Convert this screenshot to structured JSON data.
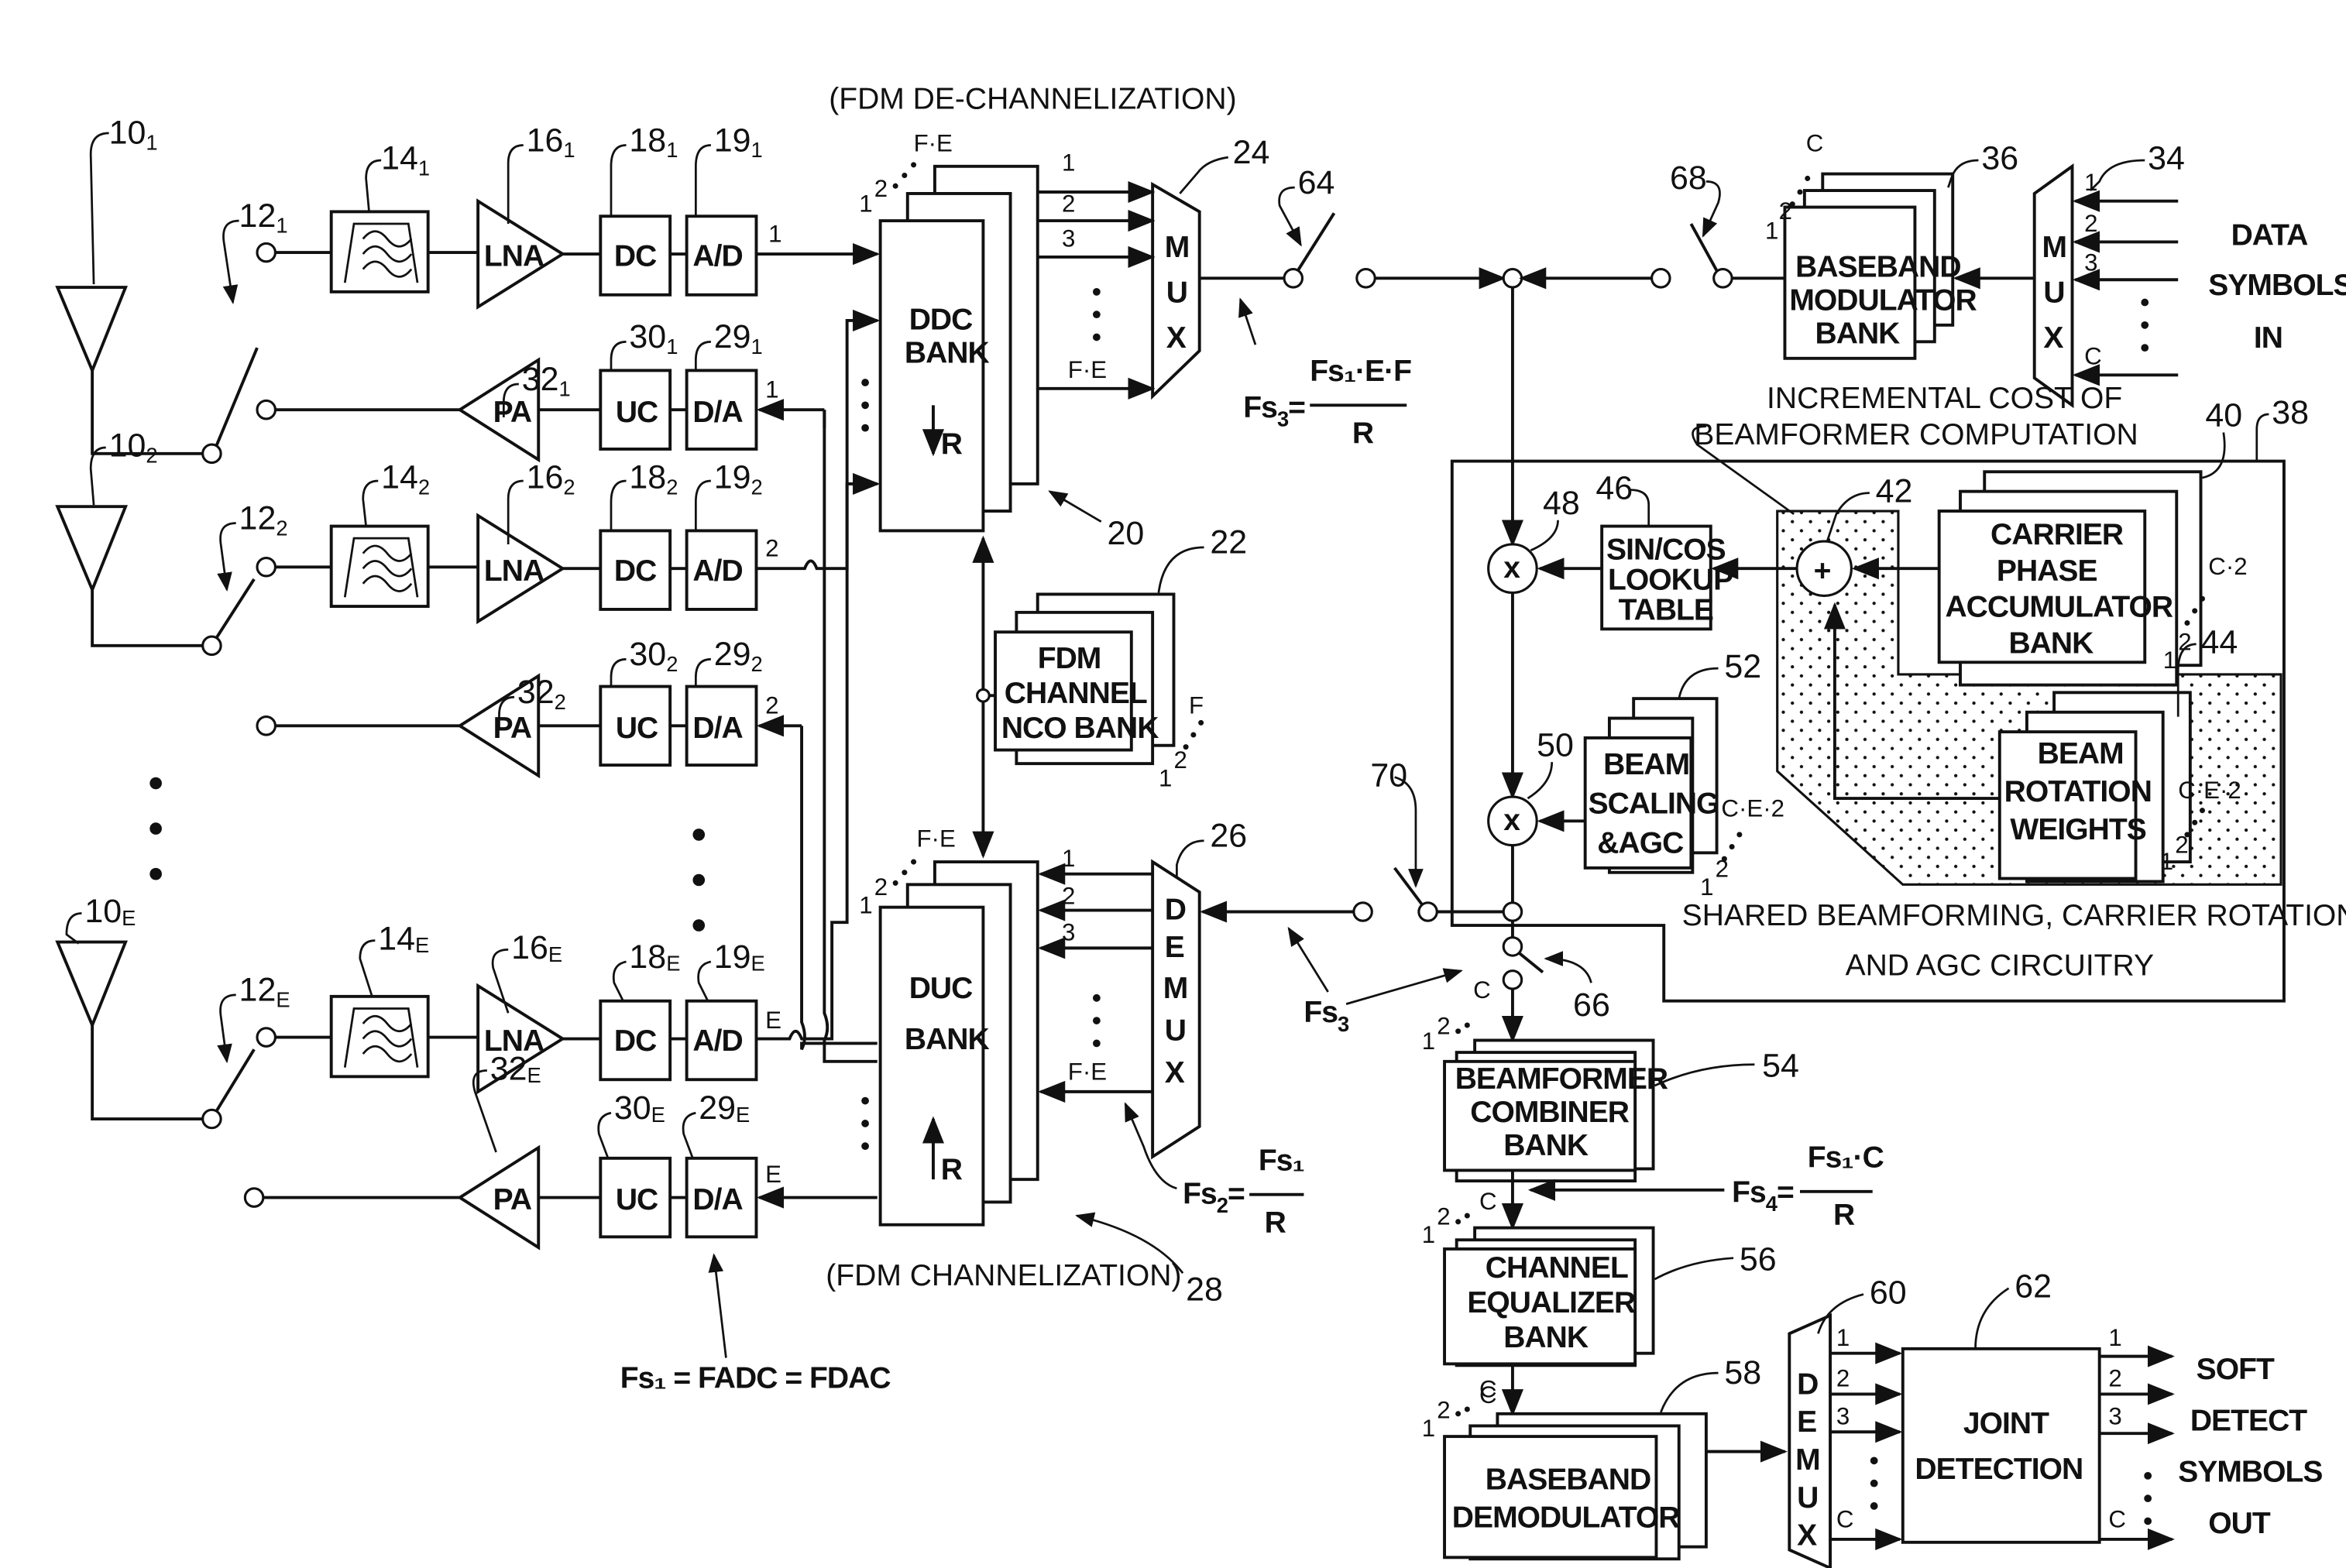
{
  "figure": {
    "headings": {
      "dechannelization": "(FDM DE-CHANNELIZATION)",
      "channelization": "(FDM CHANNELIZATION)",
      "incremental_cost_line1": "INCREMENTAL COST OF",
      "incremental_cost_line2": "BEAMFORMER COMPUTATION",
      "shared_line1": "SHARED BEAMFORMING, CARRIER ROTATION,",
      "shared_line2": "AND AGC CIRCUITRY"
    },
    "antenna_rows": [
      {
        "antenna_ref": "10",
        "switch_ref": "12",
        "filter_ref": "14",
        "lna_ref": "16",
        "dc_ref": "18",
        "ad_ref": "19",
        "pa_ref": "32",
        "uc_ref": "30",
        "da_ref": "29",
        "index": "1",
        "port": "1"
      },
      {
        "antenna_ref": "10",
        "switch_ref": "12",
        "filter_ref": "14",
        "lna_ref": "16",
        "dc_ref": "18",
        "ad_ref": "19",
        "pa_ref": "32",
        "uc_ref": "30",
        "da_ref": "29",
        "index": "2",
        "port": "2"
      },
      {
        "antenna_ref": "10",
        "switch_ref": "12",
        "filter_ref": "14",
        "lna_ref": "16",
        "dc_ref": "18",
        "ad_ref": "19",
        "pa_ref": "32",
        "uc_ref": "30",
        "da_ref": "29",
        "index": "E",
        "port": "E"
      }
    ],
    "block_labels": {
      "lna": "LNA",
      "dc": "DC",
      "ad": "A/D",
      "pa": "PA",
      "uc": "UC",
      "da": "D/A"
    },
    "ddc_bank": {
      "line1": "DDC",
      "line2": "BANK",
      "rate": "R",
      "ref": "20",
      "stack_top": "F·E",
      "stack_1": "1",
      "stack_2": "2"
    },
    "duc_bank": {
      "line1": "DUC",
      "line2": "BANK",
      "rate": "R",
      "ref": "28",
      "stack_top": "F·E",
      "stack_1": "1",
      "stack_2": "2"
    },
    "nco_bank": {
      "line1": "FDM",
      "line2": "CHANNEL",
      "line3": "NCO BANK",
      "ref": "22",
      "stack_top": "F",
      "stack_1": "1",
      "stack_2": "2"
    },
    "mux_24": {
      "letters": [
        "M",
        "U",
        "X"
      ],
      "ref": "24",
      "ports": [
        "1",
        "2",
        "3",
        "F·E"
      ]
    },
    "demux_26": {
      "letters": [
        "D",
        "E",
        "M",
        "U",
        "X"
      ],
      "ref": "26",
      "ports": [
        "1",
        "2",
        "3",
        "F·E"
      ]
    },
    "switches": {
      "s64": "64",
      "s68": "68",
      "s70": "70",
      "s66": "66"
    },
    "rates": {
      "fs3_lhs": "Fs",
      "fs3_sub": "3",
      "fs3_num": "Fs₁·E·F",
      "fs3_den": "R",
      "fs2_lhs": "Fs",
      "fs2_sub": "2",
      "fs2_num": "Fs₁",
      "fs2_den": "R",
      "fs4_lhs": "Fs",
      "fs4_sub": "4",
      "fs4_num": "Fs₁·C",
      "fs4_den": "R",
      "fs3_lower": "Fs",
      "fs3_lower_sub": "3",
      "fs1_eq": "Fs₁ = FADC = FDAC"
    },
    "baseband_mod": {
      "line1": "BASEBAND",
      "line2": "MODULATOR",
      "line3": "BANK",
      "ref": "36",
      "stack_top": "C",
      "stack_1": "1",
      "stack_2": "2"
    },
    "mux_34": {
      "letters": [
        "M",
        "U",
        "X"
      ],
      "ref": "34",
      "ports": [
        "1",
        "2",
        "3",
        "C"
      ]
    },
    "data_in": {
      "line1": "DATA",
      "line2": "SYMBOLS",
      "line3": "IN"
    },
    "shared_block": {
      "ref": "38"
    },
    "multiplier_48": {
      "symbol": "x",
      "ref": "48"
    },
    "multiplier_50": {
      "symbol": "x",
      "ref": "50"
    },
    "adder_42": {
      "symbol": "+",
      "ref": "42"
    },
    "sincos": {
      "line1": "SIN/COS",
      "line2": "LOOKUP",
      "line3": "TABLE",
      "ref": "46"
    },
    "carrier_acc": {
      "line1": "CARRIER",
      "line2": "PHASE",
      "line3": "ACCUMULATOR",
      "line4": "BANK",
      "ref": "40",
      "stack_top": "C·2",
      "stack_1": "1",
      "stack_2": "2"
    },
    "beam_rot": {
      "line1": "BEAM",
      "line2": "ROTATION",
      "line3": "WEIGHTS",
      "ref": "44",
      "stack_top": "C·E·2",
      "stack_1": "1",
      "stack_2": "2"
    },
    "beam_scale": {
      "line1": "BEAM",
      "line2": "SCALING",
      "line3": "&AGC",
      "ref": "52",
      "stack_top": "C·E·2",
      "stack_1": "1",
      "stack_2": "2"
    },
    "combiner": {
      "line1": "BEAMFORMER",
      "line2": "COMBINER",
      "line3": "BANK",
      "ref": "54",
      "stack_top": "C",
      "stack_1": "1",
      "stack_2": "2"
    },
    "equalizer": {
      "line1": "CHANNEL",
      "line2": "EQUALIZER",
      "line3": "BANK",
      "ref": "56",
      "stack_top": "C",
      "stack_1": "1",
      "stack_2": "2"
    },
    "demodulator": {
      "line1": "BASEBAND",
      "line2": "DEMODULATOR",
      "ref": "58",
      "stack_top": "C",
      "stack_1": "1",
      "stack_2": "2"
    },
    "demux_60": {
      "letters": [
        "D",
        "E",
        "M",
        "U",
        "X"
      ],
      "ref": "60",
      "ports": [
        "1",
        "2",
        "3",
        "C"
      ]
    },
    "joint": {
      "line1": "JOINT",
      "line2": "DETECTION",
      "ref": "62",
      "ports": [
        "1",
        "2",
        "3",
        "C"
      ]
    },
    "soft_out": {
      "line1": "SOFT",
      "line2": "DETECT",
      "line3": "SYMBOLS",
      "line4": "OUT"
    },
    "colors": {
      "ink": "#111111",
      "paper": "#ffffff"
    }
  }
}
